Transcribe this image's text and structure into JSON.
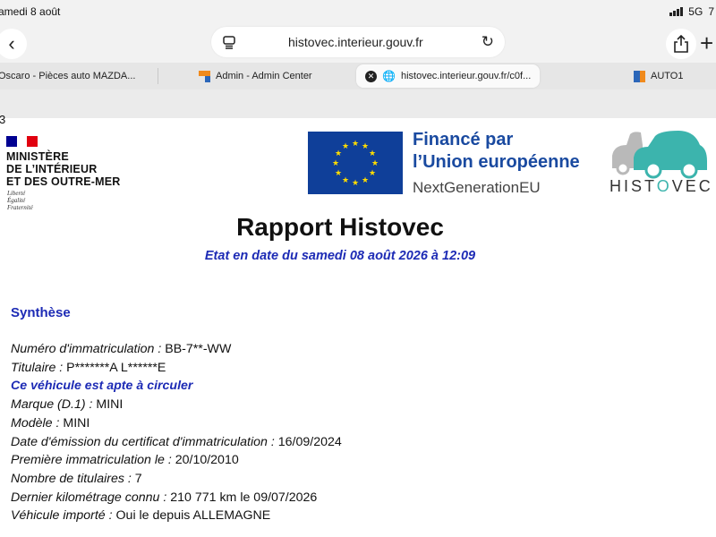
{
  "status_bar": {
    "date": "amedi 8 août",
    "network": "5G",
    "battery_partial": "7"
  },
  "browser": {
    "url": "histovec.interieur.gouv.fr",
    "tabs": [
      {
        "label": "Oscaro - Pièces auto MAZDA...",
        "icon": "oscaro-favicon"
      },
      {
        "label": "Admin - Admin Center",
        "icon": "admin-favicon"
      },
      {
        "label": "histovec.interieur.gouv.fr/c0f...",
        "icon": "globe-icon",
        "active": true
      },
      {
        "label": "AUTO1",
        "icon": "auto1-favicon"
      }
    ]
  },
  "page": {
    "page_number": "3",
    "ministry": {
      "line1": "MINISTÈRE",
      "line2": "DE L’INTÉRIEUR",
      "line3": "ET DES OUTRE-MER",
      "motto1": "Liberté",
      "motto2": "Égalité",
      "motto3": "Fraternité"
    },
    "eu": {
      "line1": "Financé par",
      "line2": "l’Union européenne",
      "line3": "NextGenerationEU"
    },
    "histovec_logo": {
      "part1": "HIST",
      "part2": "O",
      "part3": "VEC"
    },
    "title": "Rapport Histovec",
    "subtitle": "Etat en date du samedi 08 août 2026 à 12:09",
    "section_title": "Synthèse",
    "fields": [
      {
        "label": "Numéro d'immatriculation :",
        "value": "BB-7**-WW"
      },
      {
        "label": "Titulaire :",
        "value": "P*******A L******E"
      },
      {
        "label": "Ce véhicule est apte à circuler",
        "value": ""
      },
      {
        "label": "Marque (D.1) :",
        "value": "MINI"
      },
      {
        "label": "Modèle :",
        "value": "MINI"
      },
      {
        "label": "Date d'émission du certificat d'immatriculation :",
        "value": "16/09/2024"
      },
      {
        "label": "Première immatriculation le  :",
        "value": "20/10/2010"
      },
      {
        "label": "Nombre de titulaires :",
        "value": "7"
      },
      {
        "label": "Dernier kilométrage connu :",
        "value": "210 771 km le 09/07/2026"
      },
      {
        "label": "Véhicule importé :",
        "value": "Oui le  depuis ALLEMAGNE"
      }
    ]
  },
  "colors": {
    "blue_text": "#1d2bb5",
    "eu_blue": "#0f3f99",
    "eu_star": "#ffdd00",
    "histovec_teal": "#3cb4ad",
    "flag_blue": "#000091",
    "flag_red": "#e1000f"
  }
}
